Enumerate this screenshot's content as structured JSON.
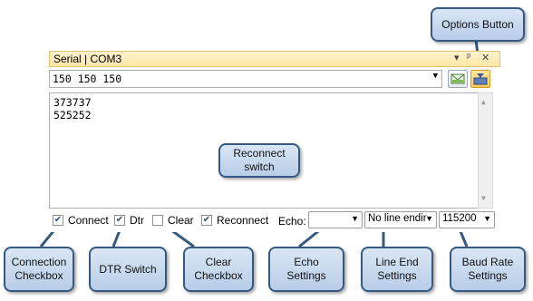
{
  "window": {
    "title": "Serial | COM3",
    "pin_glyph": "▾ ‡ ✕"
  },
  "send": {
    "value": "150 150 150",
    "dropdown_glyph": "▼"
  },
  "output": {
    "lines": [
      "373737",
      "525252"
    ]
  },
  "controls": {
    "connect_label": "Connect",
    "connect_checked": true,
    "dtr_label": "Dtr",
    "dtr_checked": true,
    "clear_label": "Clear",
    "clear_checked": false,
    "reconnect_label": "Reconnect",
    "reconnect_checked": true,
    "echo_label": "Echo:",
    "echo_value": "",
    "line_end_value": "No line endir",
    "baud_value": "115200"
  },
  "callouts": {
    "options_button": "Options Button",
    "reconnect_switch": "Reconnect\nswitch",
    "connection_checkbox": "Connection\nCheckbox",
    "dtr_switch": "DTR Switch",
    "clear_checkbox": "Clear\nCheckbox",
    "echo_settings": "Echo\nSettings",
    "line_end_settings": "Line End\nSettings",
    "baud_rate_settings": "Baud Rate\nSettings"
  },
  "colors": {
    "callout_border": "#35597f",
    "title_bg": "#fde7a6"
  }
}
